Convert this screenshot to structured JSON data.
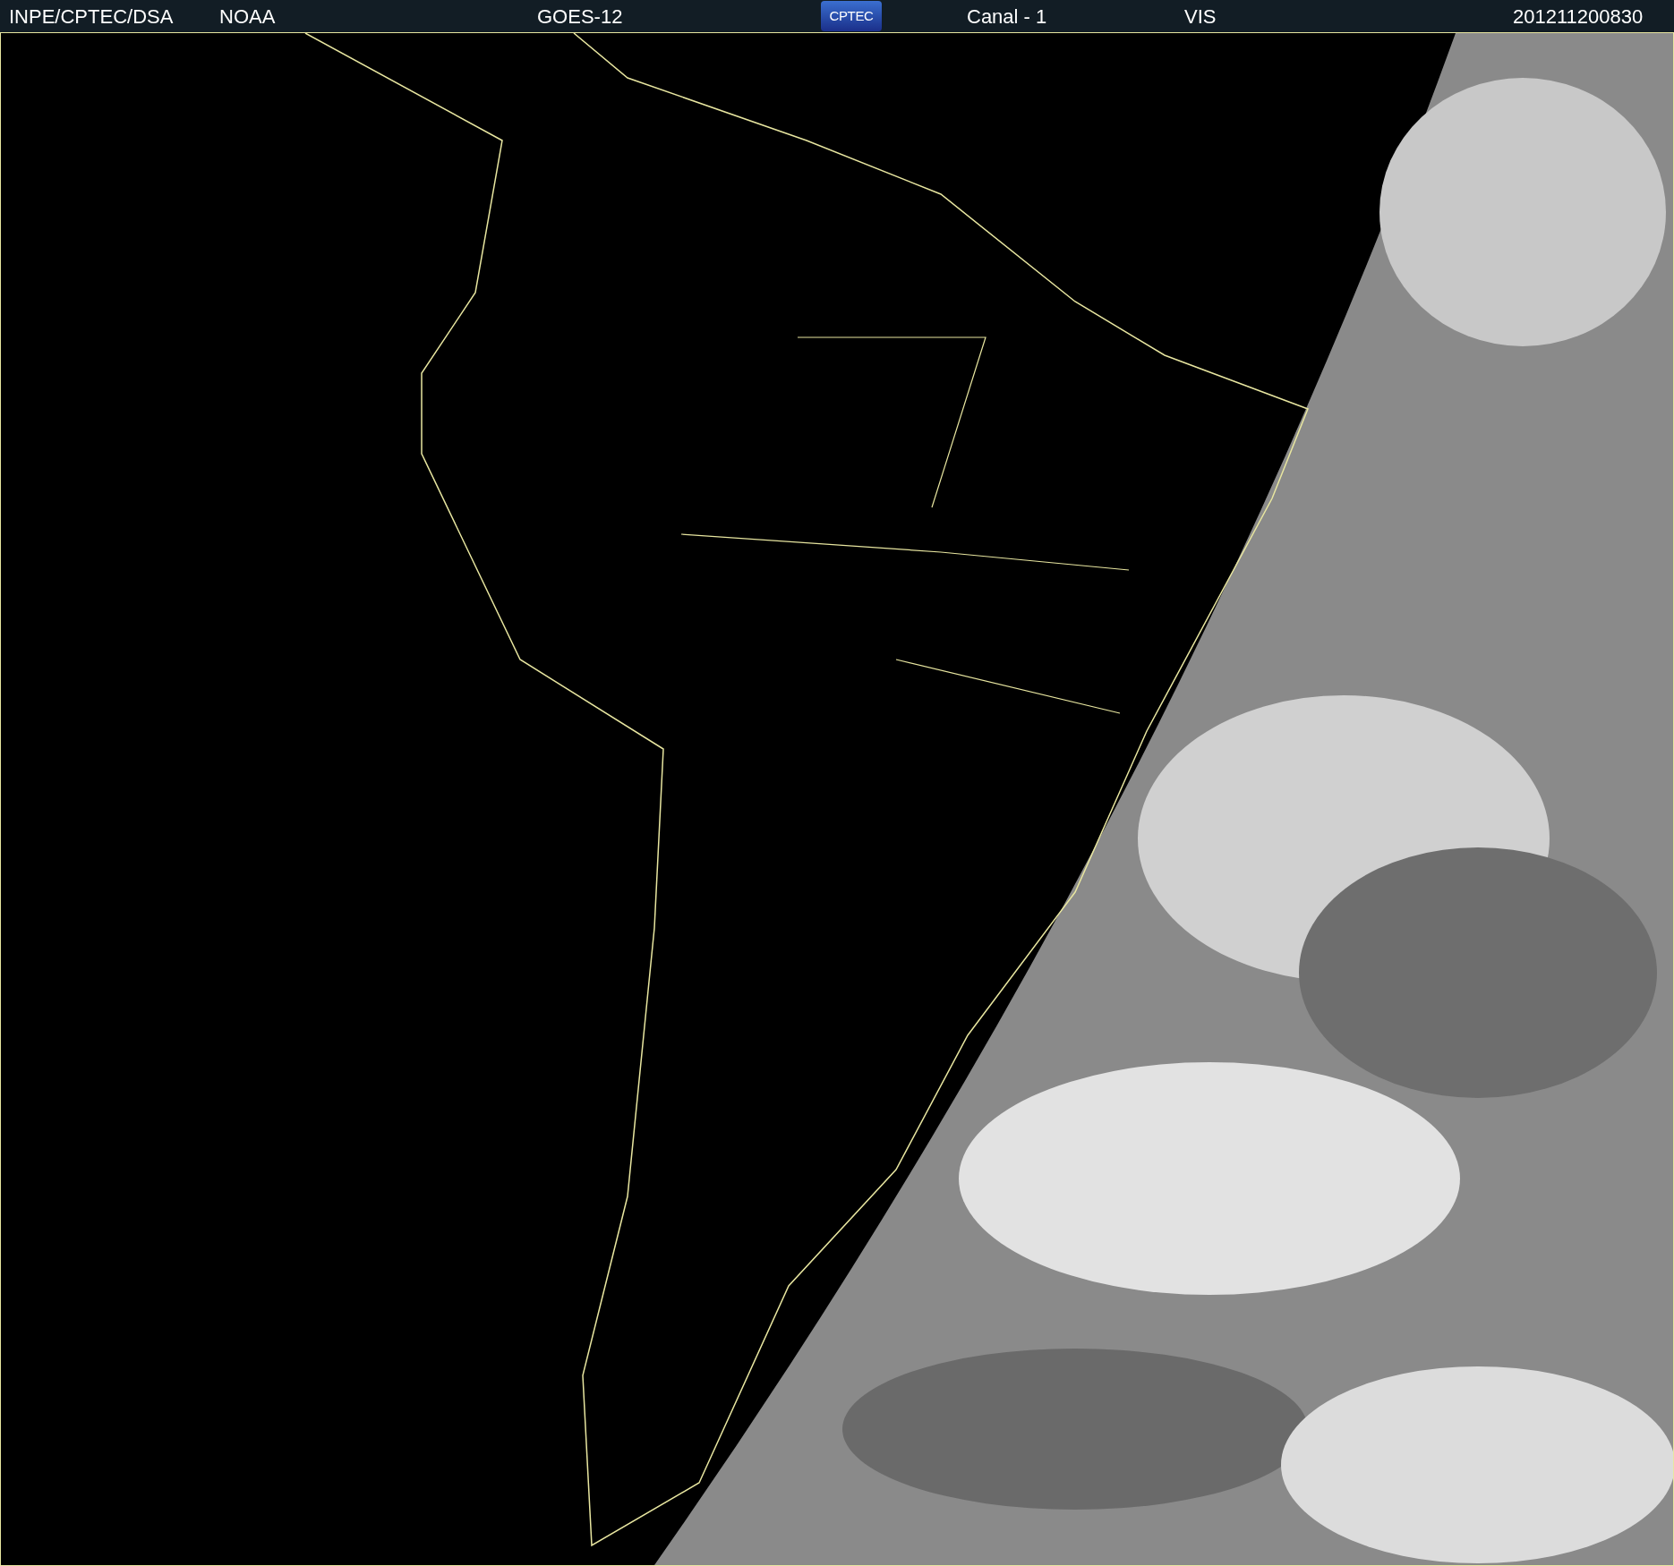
{
  "header": {
    "source": "INPE/CPTEC/DSA",
    "agency": "NOAA",
    "satellite": "GOES-12",
    "logo": "CPTEC",
    "channel": "Canal - 1",
    "band": "VIS",
    "timestamp": "201211200830"
  }
}
